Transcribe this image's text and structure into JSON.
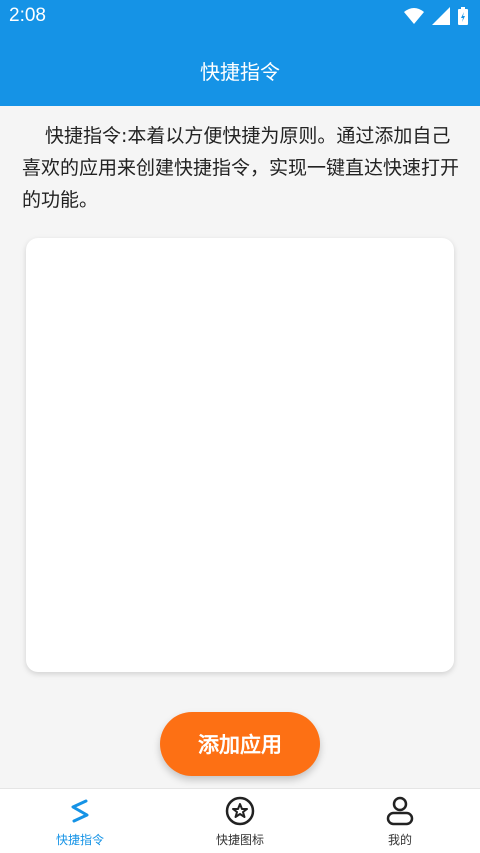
{
  "status_bar": {
    "time": "2:08"
  },
  "app_bar": {
    "title": "快捷指令"
  },
  "intro": {
    "text": "快捷指令:本着以方便快捷为原则。通过添加自己喜欢的应用来创建快捷指令，实现一键直达快速打开的功能。"
  },
  "actions": {
    "add_app_label": "添加应用"
  },
  "bottom_nav": {
    "items": [
      {
        "label": "快捷指令",
        "icon": "shortcut-s-icon",
        "active": true
      },
      {
        "label": "快捷图标",
        "icon": "star-circle-icon",
        "active": false
      },
      {
        "label": "我的",
        "icon": "person-icon",
        "active": false
      }
    ]
  },
  "colors": {
    "primary": "#1593e6",
    "accent": "#fd7014",
    "background": "#f5f5f5"
  }
}
